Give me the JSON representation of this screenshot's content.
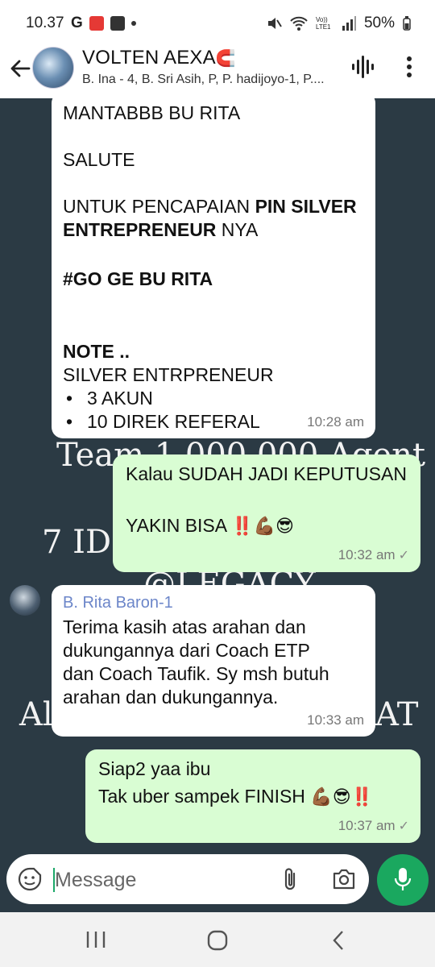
{
  "status_bar": {
    "time": "10.37",
    "battery": "50%",
    "lte_label": "Vo)) LTE1",
    "left_icons": [
      "google-icon",
      "pdf-icon",
      "app-icon",
      "dot-icon"
    ],
    "right_icons": [
      "mute-icon",
      "wifi-icon",
      "lte-icon",
      "signal-icon",
      "battery-icon"
    ]
  },
  "header": {
    "title": "VOLTEN AEXA",
    "title_emoji": "🧲",
    "subtitle": "B. Ina - 4, B. Sri Asih, P, P. hadijoyo-1, P...."
  },
  "background_texts": [
    "Team 1.000.000 Agent",
    "7 ID",
    "@LEGACY",
    "Al",
    "AT"
  ],
  "messages": [
    {
      "direction": "incoming",
      "lines": [
        {
          "text": "MANTABBB BU RITA"
        },
        {
          "text": "SALUTE"
        },
        {
          "pre": "UNTUK PENCAPAIAN ",
          "bold": "PIN SILVER"
        },
        {
          "bold": "ENTREPRENEUR",
          "post": " NYA"
        },
        {
          "bold": "#GO GE BU RITA"
        },
        {
          "bold": "NOTE .."
        },
        {
          "text": "SILVER ENTRPRENEUR"
        },
        {
          "bullet": "•",
          "text": "3 AKUN"
        },
        {
          "bullet": "•",
          "text": "10 DIREK REFERAL"
        }
      ],
      "time": "10:28 am"
    },
    {
      "direction": "outgoing",
      "lines": [
        {
          "text": "Kalau SUDAH JADI KEPUTUSAN"
        },
        {
          "text": "YAKIN BISA",
          "emojis": "‼️💪🏾😎"
        }
      ],
      "time": "10:32 am",
      "status": "✓"
    },
    {
      "direction": "incoming",
      "sender": "B. Rita Baron-1",
      "lines": [
        {
          "text": "Terima kasih atas arahan dan"
        },
        {
          "text": "dukungannya dari Coach ETP"
        },
        {
          "text": "dan Coach Taufik. Sy msh butuh"
        },
        {
          "text": "arahan dan dukungannya."
        }
      ],
      "time": "10:33 am"
    },
    {
      "direction": "outgoing",
      "lines": [
        {
          "text": "Siap2 yaa ibu"
        },
        {
          "text": "Tak uber sampek FINISH",
          "emojis": "💪🏾😎‼️"
        }
      ],
      "time": "10:37 am",
      "status": "✓"
    }
  ],
  "input": {
    "placeholder": "Message"
  },
  "colors": {
    "chat_bg": "#2b3a44",
    "incoming": "#ffffff",
    "outgoing": "#d9fdd3",
    "mic": "#1aa85f",
    "sender": "#6c86c9"
  }
}
